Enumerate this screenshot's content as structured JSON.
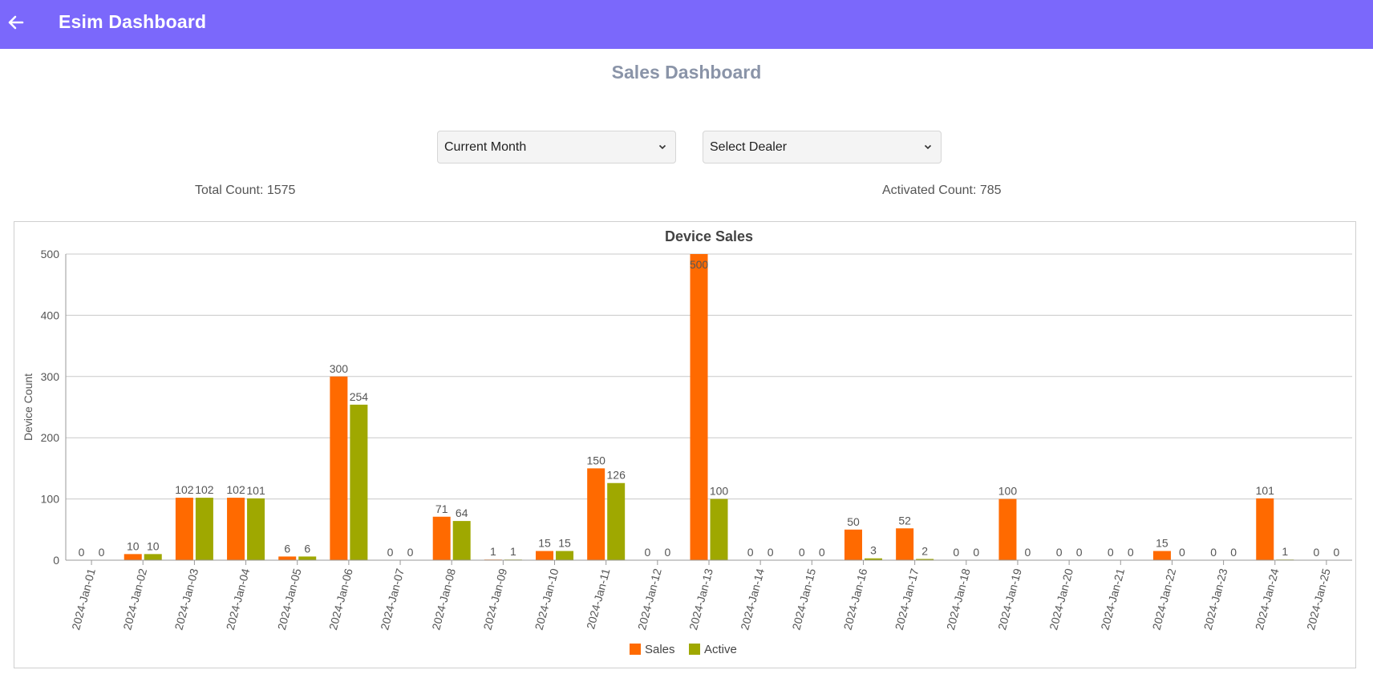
{
  "header": {
    "back_icon": "arrow-left-icon",
    "title": "Esim Dashboard",
    "color": "#7b68fb"
  },
  "page": {
    "title": "Sales Dashboard"
  },
  "filters": {
    "period": {
      "selected": "Current Month",
      "icon": "chevron-down-icon"
    },
    "dealer": {
      "selected": "Select Dealer",
      "icon": "chevron-down-icon"
    }
  },
  "counts": {
    "total": "Total Count: 1575",
    "activated": "Activated Count: 785"
  },
  "chart_data": {
    "type": "bar",
    "title": "Device Sales",
    "xlabel": "",
    "ylabel": "Device Count",
    "ylim": [
      0,
      500
    ],
    "yticks": [
      0,
      100,
      200,
      300,
      400,
      500
    ],
    "grid": true,
    "legend_position": "bottom-center",
    "categories": [
      "2024-Jan-01",
      "2024-Jan-02",
      "2024-Jan-03",
      "2024-Jan-04",
      "2024-Jan-05",
      "2024-Jan-06",
      "2024-Jan-07",
      "2024-Jan-08",
      "2024-Jan-09",
      "2024-Jan-10",
      "2024-Jan-11",
      "2024-Jan-12",
      "2024-Jan-13",
      "2024-Jan-14",
      "2024-Jan-15",
      "2024-Jan-16",
      "2024-Jan-17",
      "2024-Jan-18",
      "2024-Jan-19",
      "2024-Jan-20",
      "2024-Jan-21",
      "2024-Jan-22",
      "2024-Jan-23",
      "2024-Jan-24",
      "2024-Jan-25"
    ],
    "series": [
      {
        "name": "Sales",
        "color": "#ff6a00",
        "values": [
          0,
          10,
          102,
          102,
          6,
          300,
          0,
          71,
          1,
          15,
          150,
          0,
          500,
          0,
          0,
          50,
          52,
          0,
          100,
          0,
          0,
          15,
          0,
          101,
          0
        ]
      },
      {
        "name": "Active",
        "color": "#9fa800",
        "values": [
          0,
          10,
          102,
          101,
          6,
          254,
          0,
          64,
          1,
          15,
          126,
          0,
          100,
          0,
          0,
          3,
          2,
          0,
          0,
          0,
          0,
          0,
          0,
          1,
          0
        ]
      }
    ]
  }
}
